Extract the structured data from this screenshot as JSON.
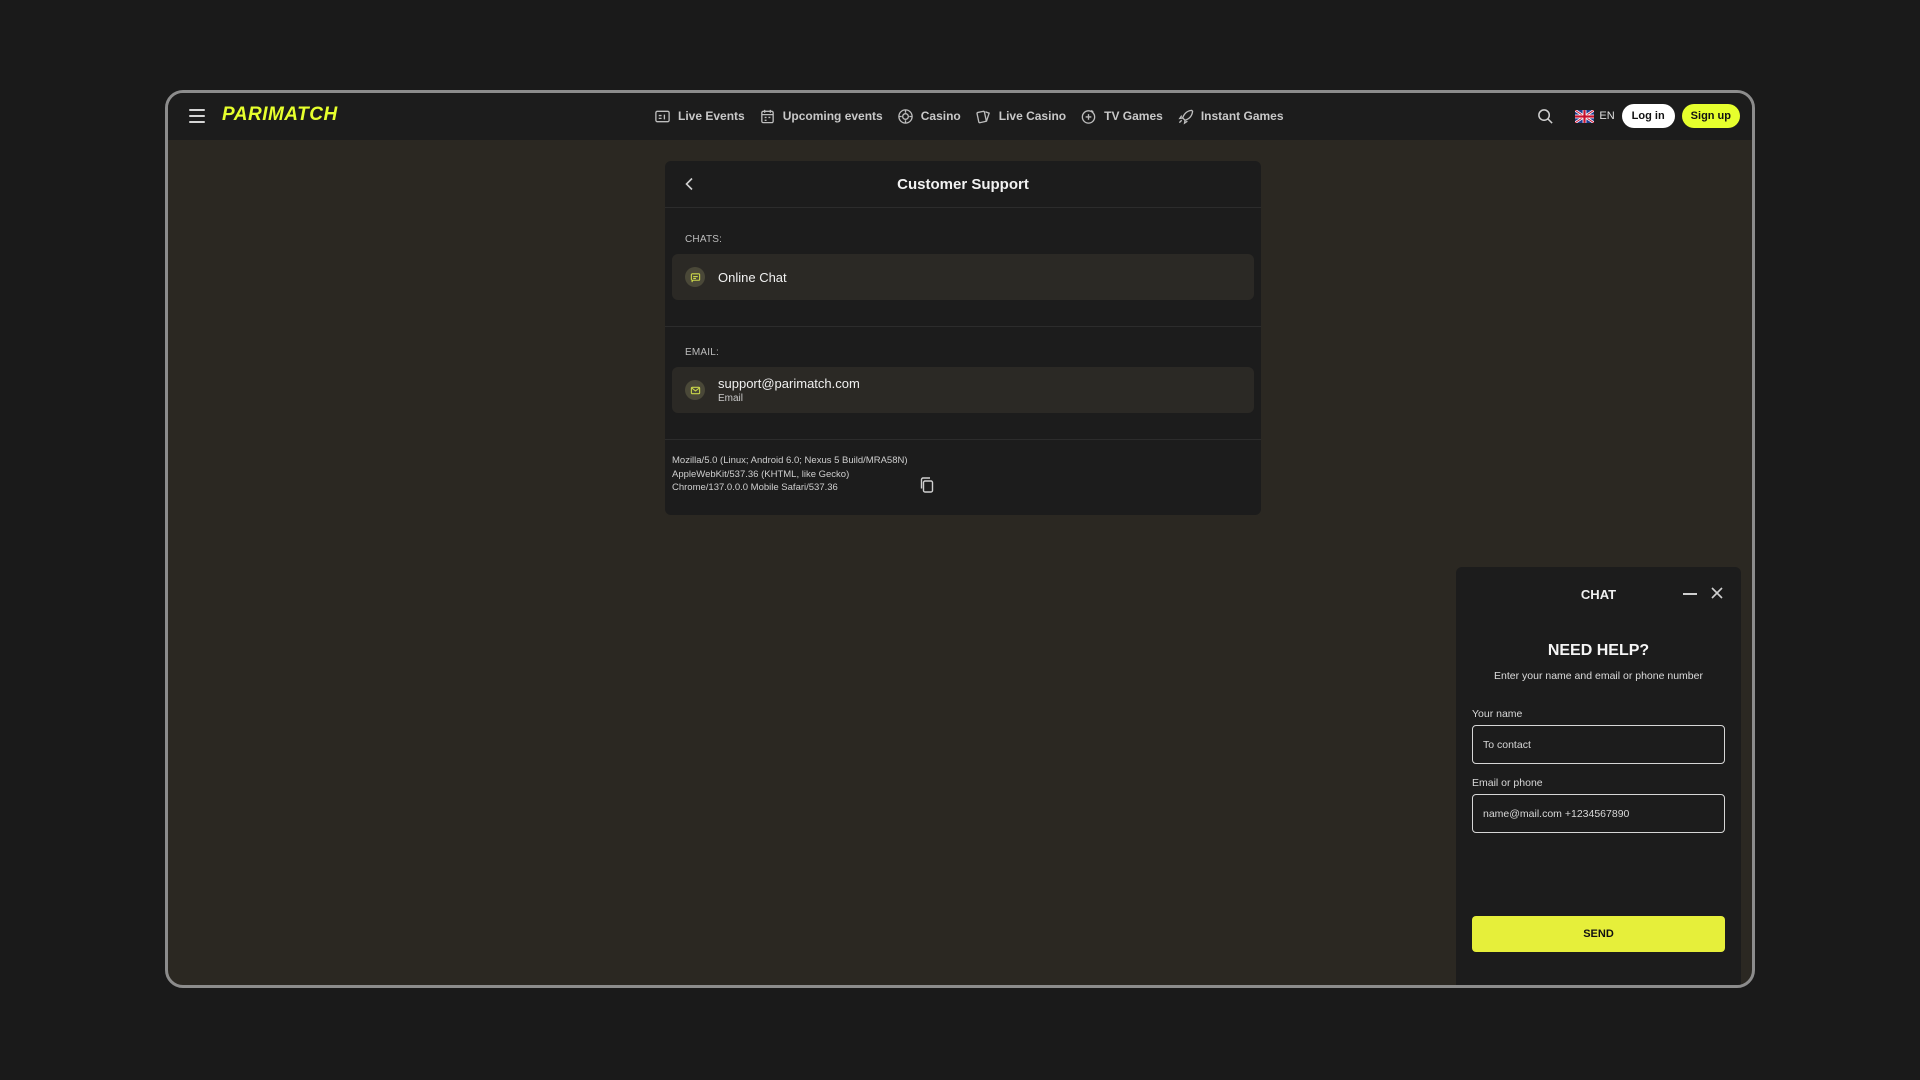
{
  "header": {
    "logo": "PARIMATCH",
    "nav": [
      {
        "label": "Live Events",
        "icon": "live-events-icon"
      },
      {
        "label": "Upcoming events",
        "icon": "calendar-icon"
      },
      {
        "label": "Casino",
        "icon": "casino-chip-icon"
      },
      {
        "label": "Live Casino",
        "icon": "cards-icon"
      },
      {
        "label": "TV Games",
        "icon": "tv-games-icon"
      },
      {
        "label": "Instant Games",
        "icon": "rocket-icon"
      }
    ],
    "lang": "EN",
    "login_label": "Log in",
    "signup_label": "Sign up"
  },
  "support": {
    "title": "Customer Support",
    "chats_label": "CHATS:",
    "online_chat": "Online Chat",
    "email_label": "EMAIL:",
    "email_address": "support@parimatch.com",
    "email_sub": "Email",
    "user_agent_1": "Mozilla/5.0 (Linux; Android 6.0; Nexus 5 Build/MRA58N)",
    "user_agent_2": "AppleWebKit/537.36 (KHTML, like Gecko)",
    "user_agent_3": "Chrome/137.0.0.0 Mobile Safari/537.36"
  },
  "chat": {
    "title": "CHAT",
    "heading": "NEED HELP?",
    "subheading": "Enter your name and email or phone number",
    "name_label": "Your name",
    "name_placeholder": "To contact",
    "contact_label": "Email or phone",
    "contact_placeholder": "name@mail.com +1234567890",
    "send_label": "SEND"
  },
  "colors": {
    "accent": "#e6ff2d",
    "background": "#2b2822",
    "panel": "#1c1c1c"
  }
}
